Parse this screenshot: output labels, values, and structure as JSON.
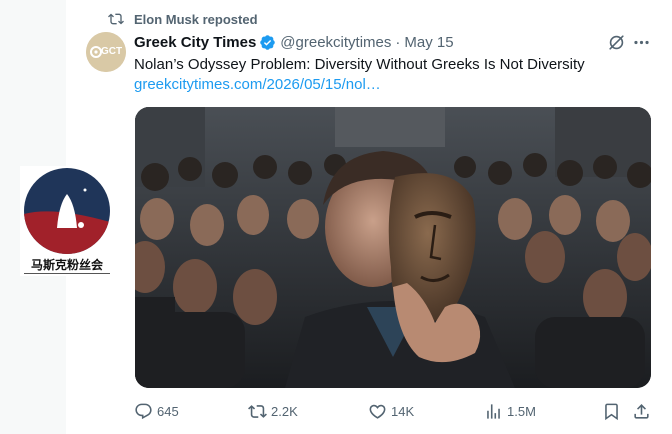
{
  "repost": {
    "text": "Elon Musk reposted",
    "icon": "repost-icon"
  },
  "author": {
    "avatar_text": "GCT",
    "name": "Greek City Times",
    "verified": true,
    "handle": "@greekcitytimes",
    "separator": "·",
    "date": "May 15"
  },
  "tweet": {
    "text": "Nolan’s Odyssey Problem: Diversity Without Greeks Is Not Diversity",
    "link": "greekcitytimes.com/2026/05/15/nol…"
  },
  "media": {
    "description_icon": "photo-crowd-mask"
  },
  "actions": {
    "replies": "645",
    "reposts": "2.2K",
    "likes": "14K",
    "views": "1.5M"
  },
  "badge": {
    "text": "马斯克粉丝会"
  },
  "colors": {
    "accent": "#1d9bf0",
    "secondary_text": "#536471",
    "primary_text": "#0f1419",
    "verified": "#1d9bf0"
  }
}
